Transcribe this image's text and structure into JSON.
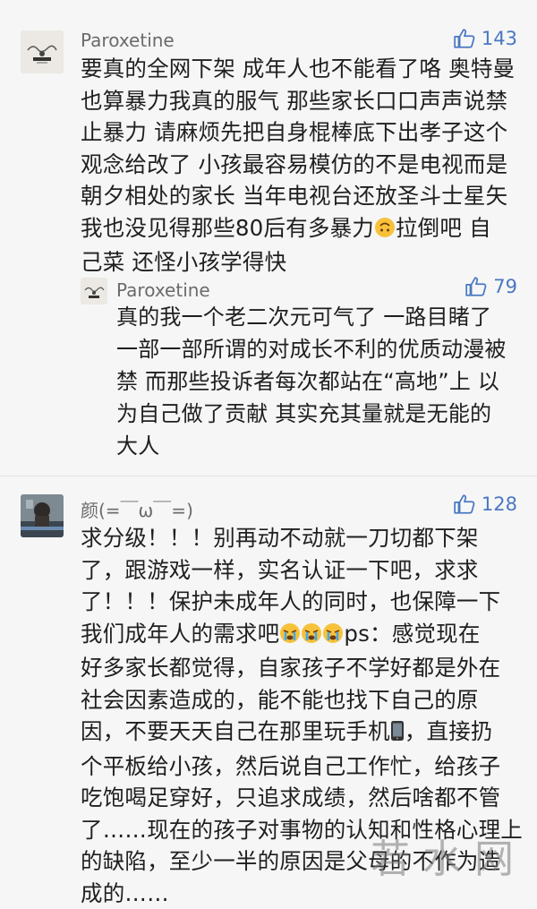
{
  "comments": [
    {
      "username": "Paroxetine",
      "likes": "143",
      "text": "要真的全网下架 成年人也不能看了咯 奥特曼\n也算暴力我真的服气 那些家长口口声声说禁\n止暴力 请麻烦先把自身棍棒底下出孝子这个\n观念给改了 小孩最容易模仿的不是电视而是\n朝夕相处的家长 当年电视台还放圣斗士星矢\n我也没见得那些80后有多暴力",
      "text_tail": "拉倒吧 自\n己菜 还怪小孩学得快",
      "emoji": "upside-down-face-icon",
      "reply": {
        "username": "Paroxetine",
        "likes": "79",
        "text": "真的我一个老二次元可气了 一路目睹了\n一部一部所谓的对成长不利的优质动漫被\n禁 而那些投诉者每次都站在“高地”上 以\n为自己做了贡献 其实充其量就是无能的\n大人"
      }
    },
    {
      "username": "颜(=￣ω￣=)",
      "likes": "128",
      "text_a": "求分级！！！别再动不动就一刀切都下架\n了，跟游戏一样，实名认证一下吧，求求\n了！！！保护未成年人的同时，也保障一下\n我们成年人的需求吧",
      "text_b": "ps：感觉现在\n好多家长都觉得，自家孩子不学好都是外在\n社会因素造成的，能不能也找下自己的原\n因，不要天天自己在那里玩手机",
      "text_c": "，直接扔\n个平板给小孩，然后说自己工作忙，给孩子\n吃饱喝足穿好，只追求成绩，然后啥都不管\n了……现在的孩子对事物的认知和性格心理上\n的缺陷，至少一半的原因是父母的不作为造\n成的……",
      "emoji_cry": "crying-face-icon",
      "emoji_phone": "mobile-phone-icon"
    }
  ],
  "watermark": "若水网",
  "colors": {
    "like_blue": "#4a78c2",
    "username_gray": "#6b6b6b",
    "background": "#f6f6f6"
  }
}
